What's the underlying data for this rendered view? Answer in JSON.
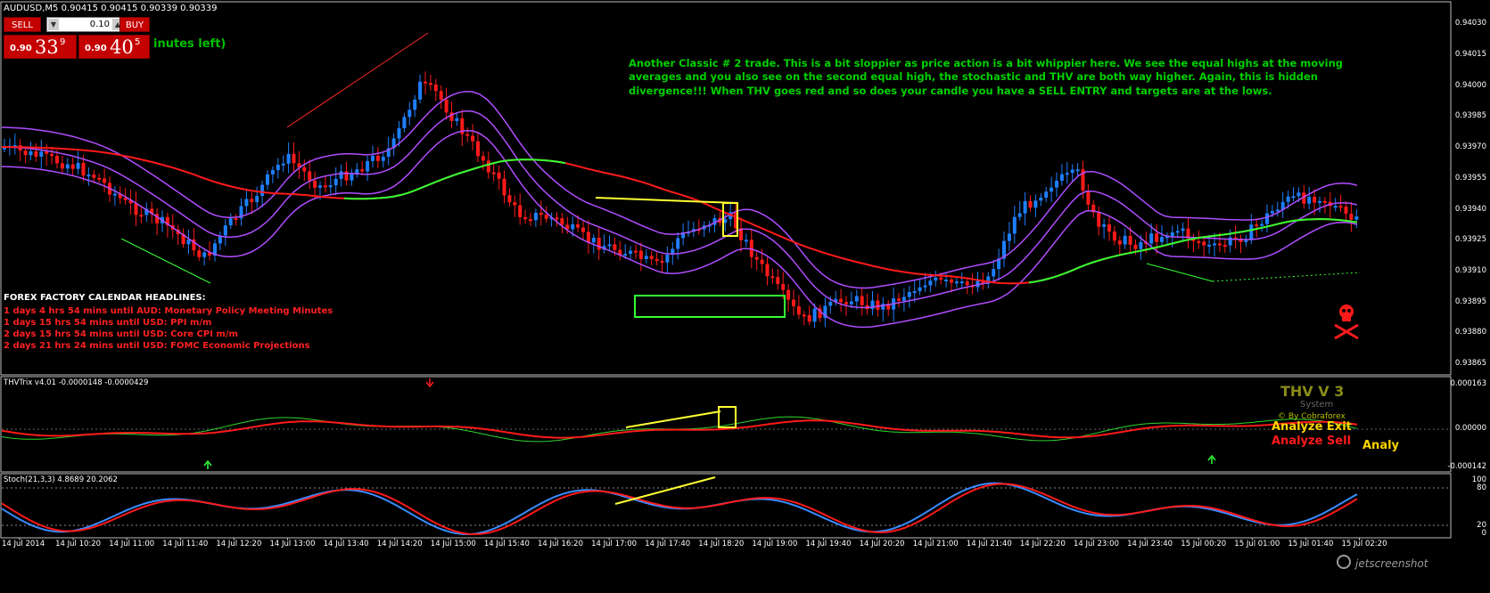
{
  "symbol_line": "AUDUSD,M5  0.90415 0.90415 0.90339 0.90339",
  "trade_panel": {
    "sell_label": "SELL",
    "buy_label": "BUY",
    "lot_value": "0.10",
    "down_arrow": "▼",
    "up_arrow": "▲",
    "sell_price_prefix": "0.90",
    "sell_price_big": "33",
    "sell_price_sup": "9",
    "buy_price_prefix": "0.90",
    "buy_price_big": "40",
    "buy_price_sup": "5"
  },
  "minutes_left": "inutes left)",
  "annotation": "Another Classic # 2 trade.  This is a bit sloppier as price action is a bit whippier here.  We see the equal highs at the moving averages and you also see on the second equal high, the stochastic and THV are both way higher.  Again, this is hidden divergence!!! When THV goes red and so does your candle you have a SELL ENTRY and targets are at the lows.",
  "news": {
    "title": "FOREX FACTORY CALENDAR HEADLINES:",
    "items": [
      "1 days 4 hrs 54 mins until AUD: Monetary Policy Meeting Minutes",
      "1 days 15 hrs 54 mins until USD: PPI m/m",
      "2 days 15 hrs 54 mins until USD: Core CPI m/m",
      "2 days 21 hrs 24 mins until USD: FOMC Economic Projections"
    ]
  },
  "price_axis": [
    "0.94030",
    "0.94015",
    "0.94000",
    "0.93985",
    "0.93970",
    "0.93955",
    "0.93940",
    "0.93925",
    "0.93910",
    "0.93895",
    "0.93880",
    "0.93865"
  ],
  "trix": {
    "header": "THVTrix v4.01 -0.0000148 -0.0000429",
    "axis": [
      "0.000163",
      "0.00000",
      "-0.000142"
    ]
  },
  "stoch": {
    "header": "Stoch(21,3,3) 4.8689 20.2062",
    "axis": [
      "100",
      "80",
      "20",
      "0"
    ]
  },
  "thv_panel": {
    "title": "THV V 3",
    "subtitle": "System",
    "credit": "© By Cobraforex",
    "exit": "Analyze Exit",
    "sell": "Analyze Sell",
    "cut": "Analy"
  },
  "time_axis": [
    "14 Jul 2014",
    "14 Jul 10:20",
    "14 Jul 11:00",
    "14 Jul 11:40",
    "14 Jul 12:20",
    "14 Jul 13:00",
    "14 Jul 13:40",
    "14 Jul 14:20",
    "14 Jul 15:00",
    "14 Jul 15:40",
    "14 Jul 16:20",
    "14 Jul 17:00",
    "14 Jul 17:40",
    "14 Jul 18:20",
    "14 Jul 19:00",
    "14 Jul 19:40",
    "14 Jul 20:20",
    "14 Jul 21:00",
    "14 Jul 21:40",
    "14 Jul 22:20",
    "14 Jul 23:00",
    "14 Jul 23:40",
    "15 Jul 00:20",
    "15 Jul 01:00",
    "15 Jul 01:40",
    "15 Jul 02:20"
  ],
  "watermark": "jetscreenshot",
  "colors": {
    "bull": "#1e7fff",
    "bear": "#ff1a1a",
    "ma_purple": "#b04dff",
    "ma_red": "#ff1a1a",
    "ma_green": "#33ff33",
    "note": "#00d000",
    "markup_yellow": "#ffff33",
    "markup_green": "#33ff33"
  }
}
